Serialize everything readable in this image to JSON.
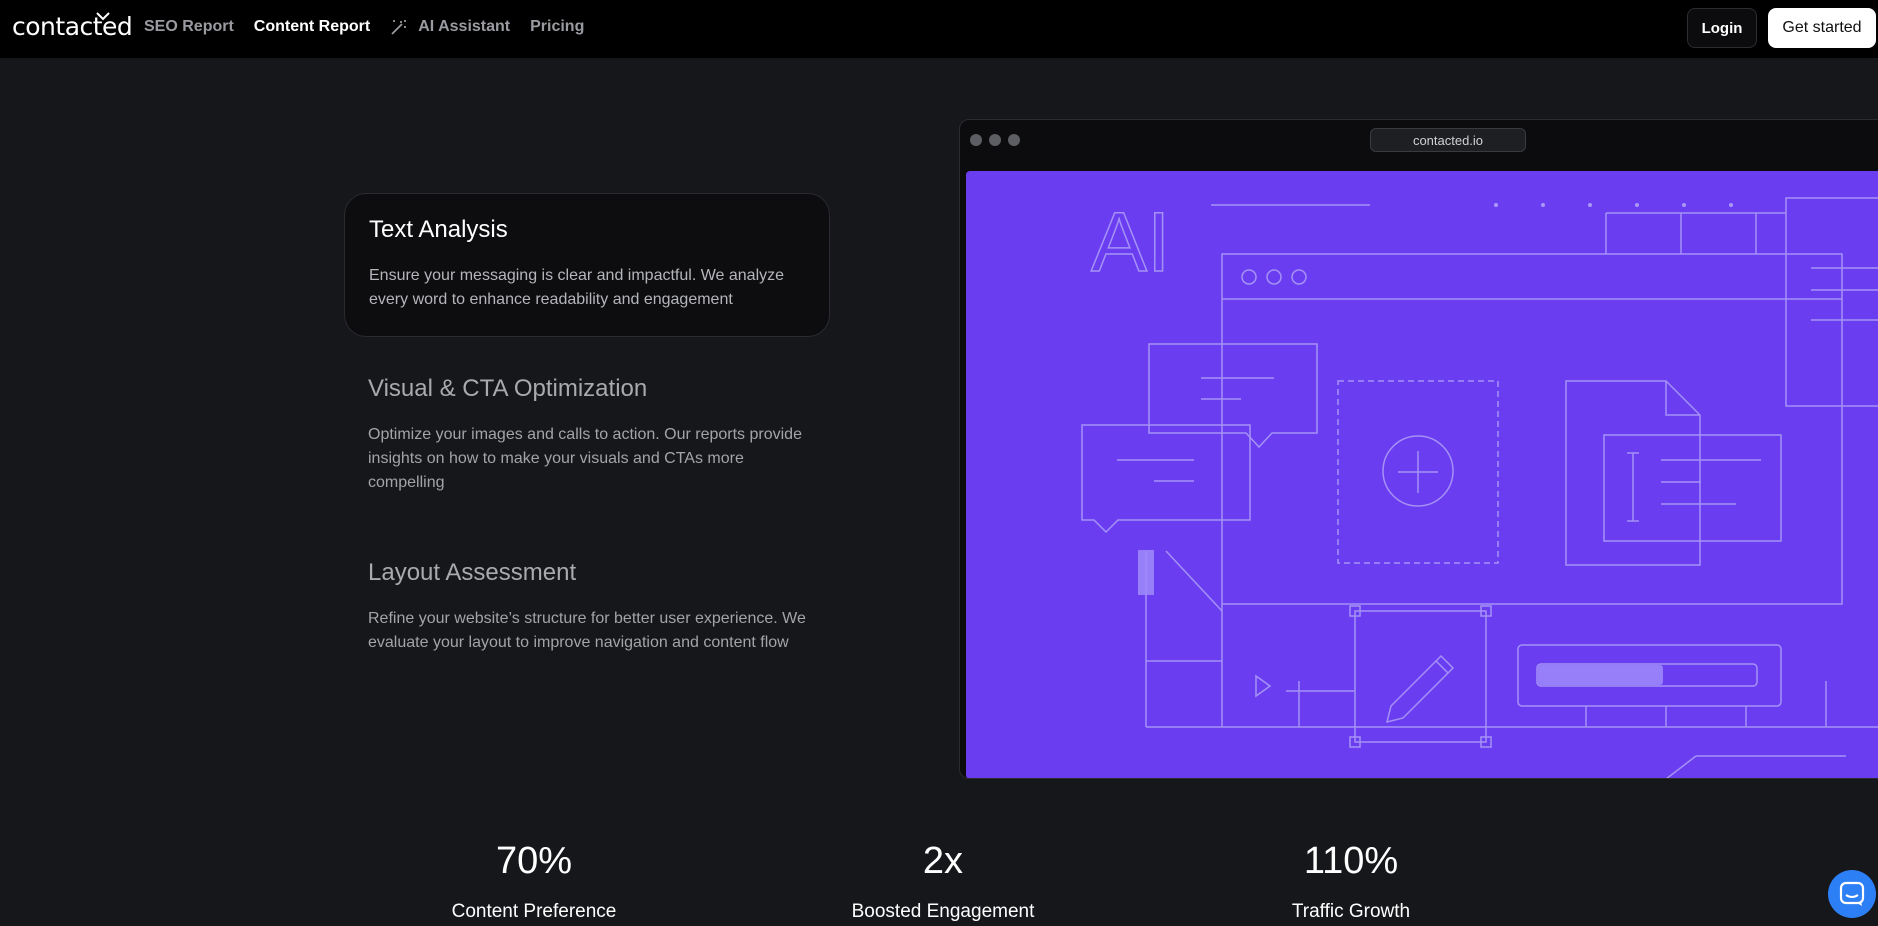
{
  "nav": {
    "logo": "contacted",
    "links": [
      {
        "label": "SEO Report"
      },
      {
        "label": "Content Report"
      },
      {
        "label": "AI Assistant"
      },
      {
        "label": "Pricing"
      }
    ],
    "login_label": "Login",
    "get_started_label": "Get started"
  },
  "features": [
    {
      "title": "Text Analysis",
      "description": "Ensure your messaging is clear and impactful. We analyze every word to enhance readability and engagement"
    },
    {
      "title": "Visual & CTA Optimization",
      "description": "Optimize your images and calls to action. Our reports provide insights on how to make your visuals and CTAs more compelling"
    },
    {
      "title": "Layout Assessment",
      "description": "Refine your website’s structure for better user experience. We evaluate your layout to improve navigation and content flow"
    }
  ],
  "browser": {
    "url": "contacted.io",
    "illustration_label": "AI"
  },
  "stats": [
    {
      "value": "70%",
      "label": "Content Preference"
    },
    {
      "value": "2x",
      "label": "Boosted Engagement"
    },
    {
      "value": "110%",
      "label": "Traffic Growth"
    }
  ],
  "colors": {
    "background": "#16171b",
    "nav": "#000000",
    "illustration": "#6a3ef0",
    "chat_button": "#2d7ff5"
  }
}
